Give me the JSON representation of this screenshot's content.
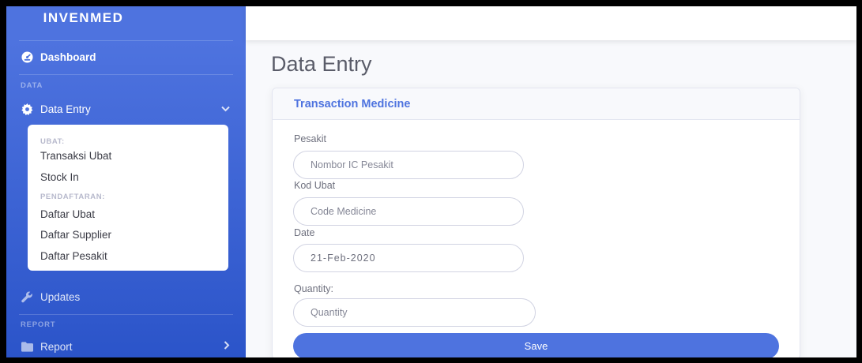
{
  "sidebar": {
    "brand": "INVENMED",
    "dashboard": {
      "label": "Dashboard",
      "icon": "tachometer-icon"
    },
    "heading_data": "DATA",
    "data_entry": {
      "label": "Data Entry",
      "icon": "gear-icon"
    },
    "submenu": {
      "heading_ubat": "UBAT:",
      "transaksi_ubat": "Transaksi Ubat",
      "stock_in": "Stock In",
      "heading_pendaftaran": "PENDAFTARAN:",
      "daftar_ubat": "Daftar Ubat",
      "daftar_supplier": "Daftar Supplier",
      "daftar_pesakit": "Daftar Pesakit"
    },
    "updates": {
      "label": "Updates",
      "icon": "wrench-icon"
    },
    "heading_report": "REPORT",
    "report": {
      "label": "Report",
      "icon": "folder-icon"
    }
  },
  "main": {
    "page_title": "Data Entry",
    "card": {
      "title": "Transaction Medicine",
      "fields": {
        "pesakit": {
          "label": "Pesakit",
          "placeholder": "Nombor IC Pesakit",
          "value": ""
        },
        "kod_ubat": {
          "label": "Kod Ubat",
          "placeholder": "Code Medicine",
          "value": ""
        },
        "date": {
          "label": "Date",
          "placeholder": "",
          "value": "21-Feb-2020"
        },
        "quantity": {
          "label": "Quantity:",
          "placeholder": "Quantity",
          "value": ""
        }
      },
      "save_label": "Save"
    }
  },
  "colors": {
    "primary": "#4e73df",
    "sidebar_dark": "#2b54c9",
    "text_muted": "#6e707e"
  }
}
